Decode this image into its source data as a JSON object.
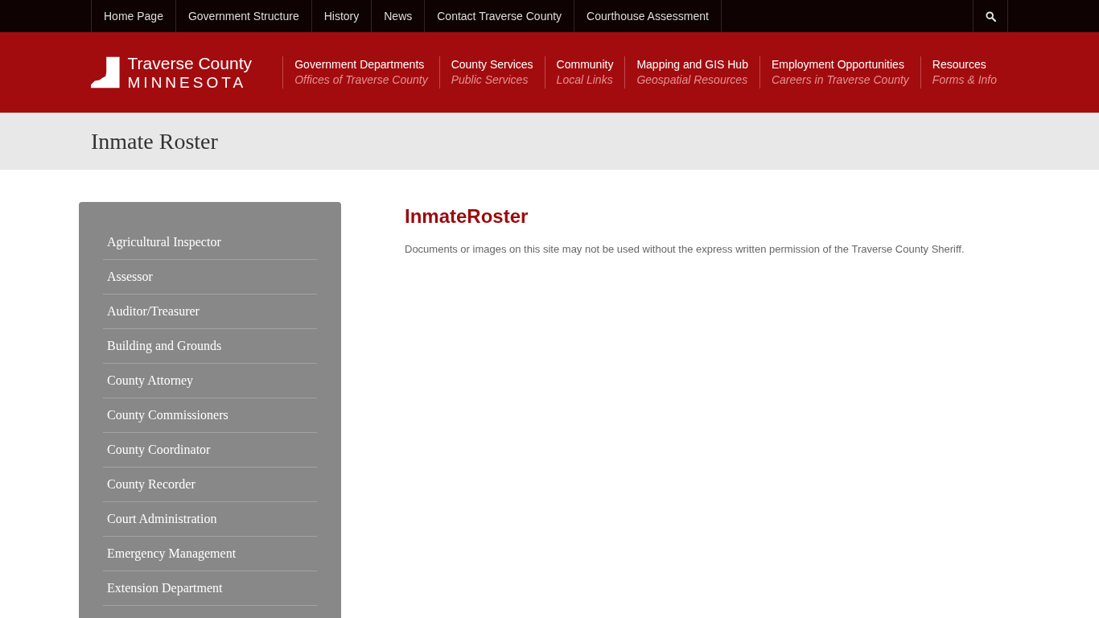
{
  "top_bar": {
    "links": [
      "Home Page",
      "Government Structure",
      "History",
      "News",
      "Contact Traverse County",
      "Courthouse Assessment"
    ]
  },
  "header": {
    "logo": {
      "name": "Traverse County",
      "state": "MINNESOTA"
    },
    "nav": [
      {
        "title": "Government Departments",
        "subtitle": "Offices of Traverse County"
      },
      {
        "title": "County Services",
        "subtitle": "Public Services"
      },
      {
        "title": "Community",
        "subtitle": "Local Links"
      },
      {
        "title": "Mapping and GIS Hub",
        "subtitle": "Geospatial Resources"
      },
      {
        "title": "Employment Opportunities",
        "subtitle": "Careers in Traverse County"
      },
      {
        "title": "Resources",
        "subtitle": "Forms & Info"
      }
    ]
  },
  "page_title": "Inmate Roster",
  "sidebar": {
    "items": [
      "Agricultural Inspector",
      "Assessor",
      "Auditor/Treasurer",
      "Building and Grounds",
      "County Attorney",
      "County Commissioners",
      "County Coordinator",
      "County Recorder",
      "Court Administration",
      "Emergency Management",
      "Extension Department"
    ]
  },
  "content": {
    "heading": "InmateRoster",
    "notice": "Documents or images on this site may not be used without the express written permission of the Traverse County Sheriff."
  }
}
